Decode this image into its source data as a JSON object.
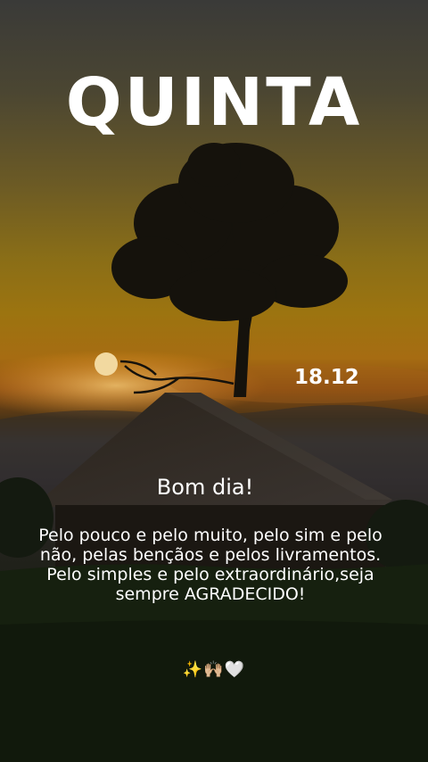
{
  "story": {
    "day": "QUINTA",
    "date": "18.12",
    "greeting": "Bom dia!",
    "message": "Pelo pouco e pelo muito, pelo sim e pelo não, pelas bençãos e pelos livramentos. Pelo simples e pelo extraordinário,seja sempre AGRADECIDO!",
    "emojis": "✨🙌🏼🤍"
  },
  "colors": {
    "text": "#ffffff",
    "sky_top": "#3a3a38",
    "sunset_orange": "#a66c12",
    "sun": "#f2d9a0",
    "silhouette": "#15120c"
  }
}
